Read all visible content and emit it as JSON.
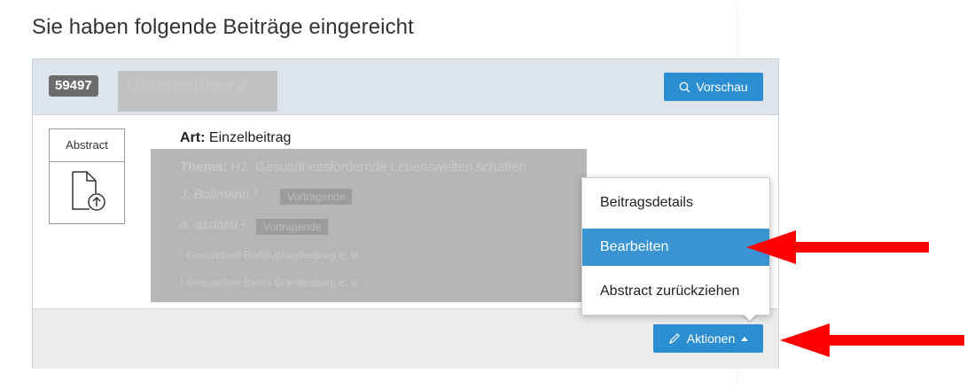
{
  "heading": "Sie haben folgende Beiträge eingereicht",
  "submission": {
    "id": "59497",
    "title": "Unterbeitrag 2",
    "preview_label": "Vorschau",
    "abstract_label": "Abstract",
    "art_label": "Art:",
    "art_value": "Einzelbeitrag",
    "theme_label": "Thema:",
    "theme_value": "H2: Gesundheitsfördernde Lebenswelten schaffen",
    "author1": "J. Bollmann ¹",
    "author1_tag": "Vortragende",
    "author2": "a. asdasd ²",
    "author2_tag": "Vortragende",
    "affil1": "¹ Gesundheit Berlin-Brandenburg e. V.",
    "affil2": "² Gesundheit Berlin-Brandenburg e. V."
  },
  "actions": {
    "button_label": "Aktionen",
    "menu": [
      "Beitragsdetails",
      "Bearbeiten",
      "Abstract zurückziehen"
    ],
    "active_index": 1
  },
  "colors": {
    "accent": "#2b8ed1",
    "menu_active": "#3a94d2",
    "annotation_arrow": "#ff0000"
  },
  "icons": [
    "search-icon",
    "file-upload-icon",
    "pencil-icon",
    "caret-up-icon",
    "red-arrow-icon"
  ]
}
